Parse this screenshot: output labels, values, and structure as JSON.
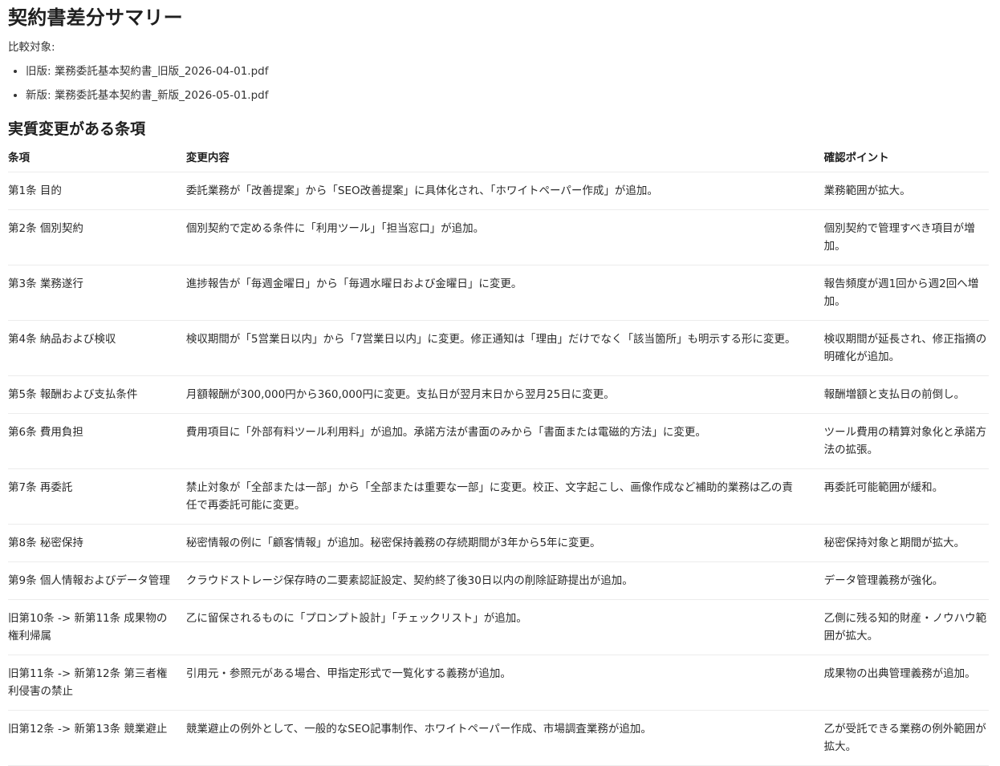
{
  "title": "契約書差分サマリー",
  "compare_label": "比較対象:",
  "files": [
    "旧版: 業務委託基本契約書_旧版_2026-04-01.pdf",
    "新版: 業務委託基本契約書_新版_2026-05-01.pdf"
  ],
  "section_title": "実質変更がある条項",
  "table": {
    "headers": [
      "条項",
      "変更内容",
      "確認ポイント"
    ],
    "rows": [
      {
        "clause": "第1条 目的",
        "change": "委託業務が「改善提案」から「SEO改善提案」に具体化され、「ホワイトペーパー作成」が追加。",
        "check": "業務範囲が拡大。"
      },
      {
        "clause": "第2条 個別契約",
        "change": "個別契約で定める条件に「利用ツール」「担当窓口」が追加。",
        "check": "個別契約で管理すべき項目が増加。"
      },
      {
        "clause": "第3条 業務遂行",
        "change": "進捗報告が「毎週金曜日」から「毎週水曜日および金曜日」に変更。",
        "check": "報告頻度が週1回から週2回へ増加。"
      },
      {
        "clause": "第4条 納品および検収",
        "change": "検収期間が「5営業日以内」から「7営業日以内」に変更。修正通知は「理由」だけでなく「該当箇所」も明示する形に変更。",
        "check": "検収期間が延長され、修正指摘の明確化が追加。"
      },
      {
        "clause": "第5条 報酬および支払条件",
        "change": "月額報酬が300,000円から360,000円に変更。支払日が翌月末日から翌月25日に変更。",
        "check": "報酬増額と支払日の前倒し。"
      },
      {
        "clause": "第6条 費用負担",
        "change": "費用項目に「外部有料ツール利用料」が追加。承諾方法が書面のみから「書面または電磁的方法」に変更。",
        "check": "ツール費用の精算対象化と承諾方法の拡張。"
      },
      {
        "clause": "第7条 再委託",
        "change": "禁止対象が「全部または一部」から「全部または重要な一部」に変更。校正、文字起こし、画像作成など補助的業務は乙の責任で再委託可能に変更。",
        "check": "再委託可能範囲が緩和。"
      },
      {
        "clause": "第8条 秘密保持",
        "change": "秘密情報の例に「顧客情報」が追加。秘密保持義務の存続期間が3年から5年に変更。",
        "check": "秘密保持対象と期間が拡大。"
      },
      {
        "clause": "第9条 個人情報およびデータ管理",
        "change": "クラウドストレージ保存時の二要素認証設定、契約終了後30日以内の削除証跡提出が追加。",
        "check": "データ管理義務が強化。"
      },
      {
        "clause": "旧第10条 -> 新第11条 成果物の権利帰属",
        "change": "乙に留保されるものに「プロンプト設計」「チェックリスト」が追加。",
        "check": "乙側に残る知的財産・ノウハウ範囲が拡大。"
      },
      {
        "clause": "旧第11条 -> 新第12条 第三者権利侵害の禁止",
        "change": "引用元・参照元がある場合、甲指定形式で一覧化する義務が追加。",
        "check": "成果物の出典管理義務が追加。"
      },
      {
        "clause": "旧第12条 -> 新第13条 競業避止",
        "change": "競業避止の例外として、一般的なSEO記事制作、ホワイトペーパー作成、市場調査業務が追加。",
        "check": "乙が受託できる業務の例外範囲が拡大。"
      }
    ]
  }
}
